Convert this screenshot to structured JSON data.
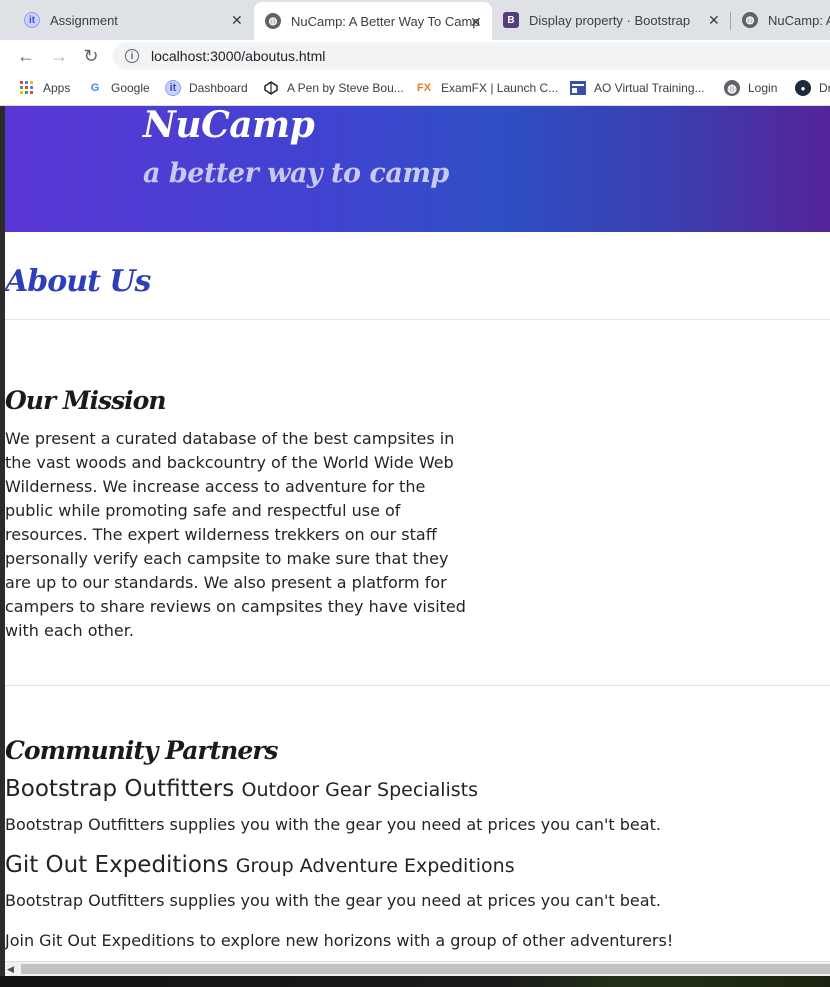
{
  "browser": {
    "tabs": [
      {
        "title": "Assignment",
        "icon": "grade-icon",
        "active": false
      },
      {
        "title": "NuCamp: A Better Way To Camp",
        "icon": "globe-icon",
        "active": true
      },
      {
        "title": "Display property · Bootstrap",
        "icon": "bootstrap-icon",
        "active": false
      },
      {
        "title": "NuCamp: A",
        "icon": "globe-icon",
        "active": false
      }
    ],
    "close_glyph": "✕",
    "url": "localhost:3000/aboutus.html",
    "info_glyph": "i",
    "nav": {
      "back": "←",
      "forward": "→",
      "reload": "↻"
    },
    "bookmarks": [
      {
        "label": "Apps",
        "icon": "apps-grid-icon"
      },
      {
        "label": "Google",
        "icon": "google-icon"
      },
      {
        "label": "Dashboard",
        "icon": "grade-icon"
      },
      {
        "label": "A Pen by Steve Bou...",
        "icon": "codepen-icon"
      },
      {
        "label": "ExamFX | Launch C...",
        "icon": "examfx-icon"
      },
      {
        "label": "AO Virtual Training...",
        "icon": "training-icon"
      },
      {
        "label": "Login",
        "icon": "globe-icon"
      },
      {
        "label": "Dr",
        "icon": "dark-circle-icon"
      }
    ],
    "bookmark_glyphs": {
      "google": "G",
      "examfx": "FX"
    }
  },
  "page": {
    "brand": "NuCamp",
    "tagline": "a better way to camp",
    "about_heading": "About Us",
    "mission": {
      "heading": "Our Mission",
      "text": "We present a curated database of the best campsites in the vast woods and backcountry of the World Wide Web Wilderness. We increase access to adventure for the public while promoting safe and respectful use of resources. The expert wilderness trekkers on our staff personally verify each campsite to make sure that they are up to our standards. We also present a platform for campers to share reviews on campsites they have visited with each other."
    },
    "partners": {
      "heading": "Community Partners",
      "items": [
        {
          "name": "Bootstrap Outfitters",
          "subtitle": "Outdoor Gear Specialists",
          "description": "Bootstrap Outfitters supplies you with the gear you need at prices you can't beat."
        },
        {
          "name": "Git Out Expeditions",
          "subtitle": "Group Adventure Expeditions",
          "description": "Bootstrap Outfitters supplies you with the gear you need at prices you can't beat."
        }
      ],
      "extra_text": "Join Git Out Expeditions to explore new horizons with a group of other adventurers!"
    }
  },
  "colors": {
    "header_gradient_start": "#5b37d6",
    "header_gradient_end": "#55249a",
    "about_heading": "#2e3fb8",
    "tagline": "#c8c8f0"
  }
}
